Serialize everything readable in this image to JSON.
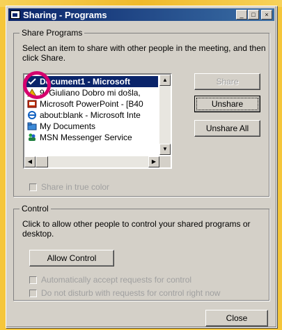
{
  "window": {
    "title": "Sharing - Programs",
    "min": "_",
    "max": "□",
    "close": "×"
  },
  "share": {
    "legend": "Share Programs",
    "description": "Select an item to share with other people in the meeting, and then click Share.",
    "items": [
      {
        "label": "Document1 - Microsoft",
        "icon": "check-icon",
        "selected": true
      },
      {
        "label": "9. Giuliano Dobro mi došla,",
        "icon": "winamp-icon"
      },
      {
        "label": "Microsoft PowerPoint - [B40",
        "icon": "powerpoint-icon"
      },
      {
        "label": "about:blank - Microsoft Inte",
        "icon": "internet-explorer-icon"
      },
      {
        "label": "My Documents",
        "icon": "folder-icon"
      },
      {
        "label": "MSN Messenger Service",
        "icon": "msn-messenger-icon"
      }
    ],
    "share_button": "Share",
    "unshare_button": "Unshare",
    "unshare_all_button": "Unshare All",
    "true_color_label": "Share in true color"
  },
  "control": {
    "legend": "Control",
    "description": "Click to allow other people to control your shared programs or desktop.",
    "allow_button": "Allow Control",
    "auto_accept_label": "Automatically accept requests for control",
    "dnd_label": "Do not disturb with requests for control right now"
  },
  "close_button": "Close",
  "colors": {
    "title_bar": "#0a246a",
    "face": "#d4d0c8",
    "selection": "#0a246a",
    "highlight_ring": "#d6006e"
  }
}
